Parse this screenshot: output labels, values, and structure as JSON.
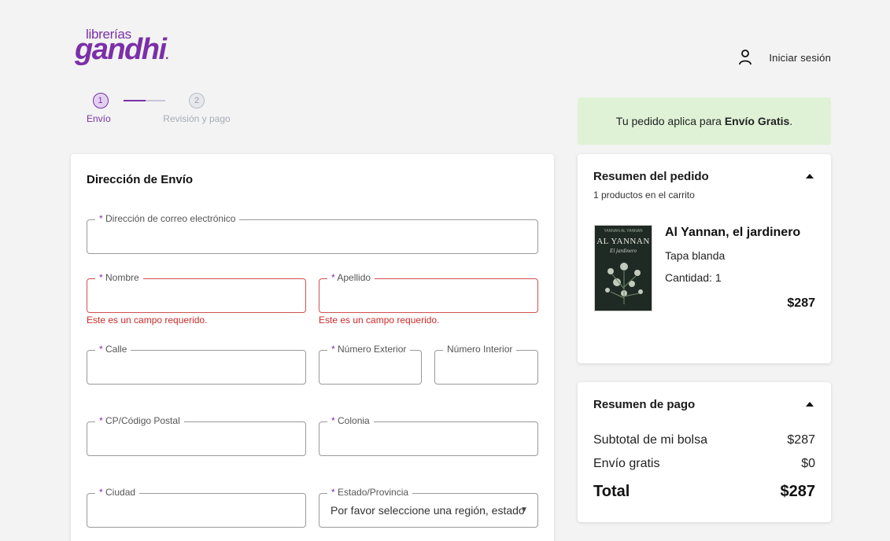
{
  "brand": {
    "small": "librerías",
    "big": "gandhi",
    "dot": "."
  },
  "header": {
    "login_label": "Iniciar sesión"
  },
  "stepper": {
    "steps": [
      {
        "number": "1",
        "label": "Envío"
      },
      {
        "number": "2",
        "label": "Revisión y pago"
      }
    ]
  },
  "form": {
    "title": "Dirección de Envío",
    "required_mark": "*",
    "fields": {
      "email": {
        "label": "Dirección de correo electrónico",
        "value": ""
      },
      "nombre": {
        "label": "Nombre",
        "value": "",
        "error": "Este es un campo requerido."
      },
      "apellido": {
        "label": "Apellido",
        "value": "",
        "error": "Este es un campo requerido."
      },
      "calle": {
        "label": "Calle",
        "value": ""
      },
      "num_ext": {
        "label": "Número Exterior",
        "value": ""
      },
      "num_int": {
        "label": "Número Interior",
        "value": ""
      },
      "cp": {
        "label": "CP/Código Postal",
        "value": ""
      },
      "colonia": {
        "label": "Colonia",
        "value": ""
      },
      "ciudad": {
        "label": "Ciudad",
        "value": ""
      },
      "estado": {
        "label": "Estado/Provincia",
        "selected": "Por favor seleccione una región, estado o provincia."
      }
    }
  },
  "banner": {
    "prefix": "Tu pedido aplica para ",
    "bold": "Envío Gratis",
    "suffix": "."
  },
  "order_summary": {
    "title": "Resumen del pedido",
    "subtitle": "1 productos en el carrito",
    "item": {
      "cover_author": "YANNAN AL YANNAN",
      "cover_title": "AL YANNAN",
      "cover_subtitle": "El jardinero",
      "title": "Al Yannan, el jardinero",
      "format": "Tapa blanda",
      "quantity": "Cantidad: 1",
      "price": "$287"
    }
  },
  "payment_summary": {
    "title": "Resumen de pago",
    "rows": [
      {
        "label": "Subtotal de mi bolsa",
        "value": "$287"
      },
      {
        "label": "Envío gratis",
        "value": "$0"
      }
    ],
    "total": {
      "label": "Total",
      "value": "$287"
    }
  },
  "colors": {
    "brand": "#7b2fa8",
    "error": "#cc2a2a",
    "banner_bg": "#dff2d6"
  }
}
